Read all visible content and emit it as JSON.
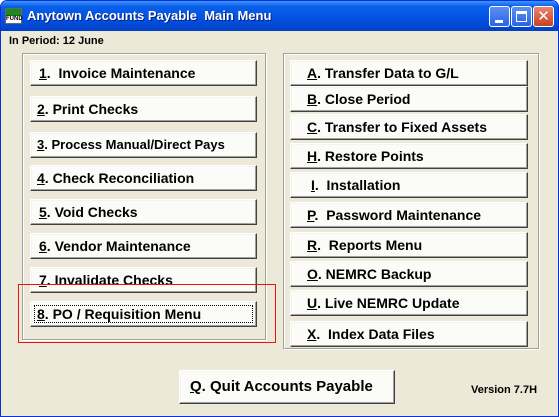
{
  "window": {
    "title": "Anytown Accounts Payable  Main Menu",
    "icon_text": "FUND",
    "controls": {
      "minimize": "minimize-icon",
      "maximize": "maximize-icon",
      "close": "close-icon",
      "close_glyph": "✕"
    }
  },
  "period_label": "In Period: 12 June",
  "left_menu": [
    {
      "key": "1",
      "label": ".  Invoice Maintenance"
    },
    {
      "key": "2",
      "label": ". Print Checks"
    },
    {
      "key": "3",
      "label": ". Process Manual/Direct Pays"
    },
    {
      "key": "4",
      "label": ". Check Reconciliation"
    },
    {
      "key": "5",
      "label": ". Void Checks"
    },
    {
      "key": "6",
      "label": ". Vendor Maintenance"
    },
    {
      "key": "7",
      "label": ". Invalidate Checks"
    },
    {
      "key": "8",
      "label": ". PO / Requisition Menu"
    }
  ],
  "right_menu": [
    {
      "key": "A",
      "label": ". Transfer Data to G/L"
    },
    {
      "key": "B",
      "label": ". Close Period"
    },
    {
      "key": "C",
      "label": ". Transfer to Fixed Assets"
    },
    {
      "key": "H",
      "label": ". Restore Points"
    },
    {
      "key": "I",
      "label": ".  Installation"
    },
    {
      "key": "P",
      "label": ".  Password Maintenance"
    },
    {
      "key": "R",
      "label": ".  Reports Menu"
    },
    {
      "key": "O",
      "label": ". NEMRC Backup"
    },
    {
      "key": "U",
      "label": ". Live NEMRC Update"
    },
    {
      "key": "X",
      "label": ".  Index Data Files"
    }
  ],
  "quit": {
    "key": "Q",
    "label": ". Quit Accounts Payable"
  },
  "version": "Version 7.7H",
  "highlight_color": "#e8140e",
  "focused_item": "8"
}
